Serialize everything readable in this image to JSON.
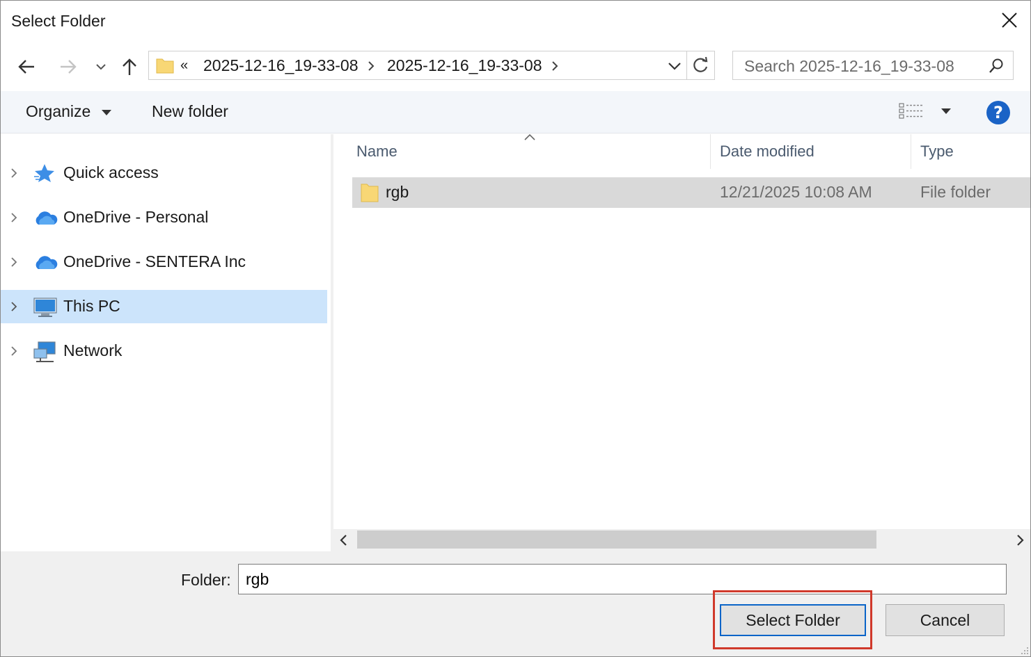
{
  "window": {
    "title": "Select Folder",
    "close_icon": "close-icon"
  },
  "nav": {
    "back_icon": "arrow-left-icon",
    "forward_icon": "arrow-right-icon",
    "recent_icon": "chevron-down-icon",
    "up_icon": "arrow-up-icon"
  },
  "address": {
    "overflow": "«",
    "crumbs": [
      "2025-12-16_19-33-08",
      "2025-12-16_19-33-08"
    ],
    "refresh_icon": "refresh-icon"
  },
  "search": {
    "placeholder": "Search 2025-12-16_19-33-08"
  },
  "toolbar": {
    "organize": "Organize",
    "new_folder": "New folder",
    "help": "?"
  },
  "sidebar": {
    "items": [
      {
        "label": "Quick access",
        "icon": "star-icon"
      },
      {
        "label": "OneDrive - Personal",
        "icon": "cloud-icon"
      },
      {
        "label": "OneDrive - SENTERA Inc",
        "icon": "cloud-icon"
      },
      {
        "label": "This PC",
        "icon": "computer-icon",
        "selected": true
      },
      {
        "label": "Network",
        "icon": "network-icon"
      }
    ]
  },
  "files": {
    "columns": [
      "Name",
      "Date modified",
      "Type"
    ],
    "rows": [
      {
        "name": "rgb",
        "date": "12/21/2025 10:08 AM",
        "type": "File folder"
      }
    ]
  },
  "footer": {
    "folder_label": "Folder:",
    "folder_value": "rgb",
    "select_button": "Select Folder",
    "cancel_button": "Cancel"
  },
  "colors": {
    "accent": "#0a64c8",
    "selection": "#cce4fb",
    "highlight": "#d0392b"
  }
}
